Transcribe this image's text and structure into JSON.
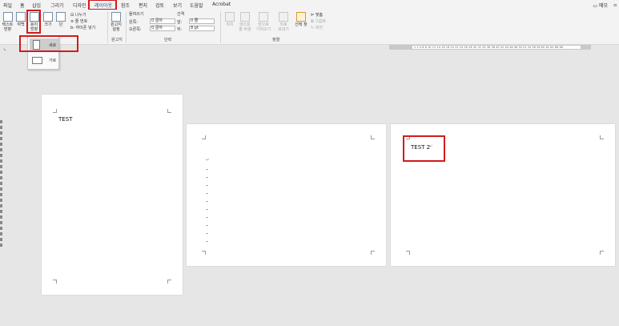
{
  "tabs": [
    {
      "label": "파일"
    },
    {
      "label": "홈"
    },
    {
      "label": "삽입"
    },
    {
      "label": "그리기"
    },
    {
      "label": "디자인"
    },
    {
      "label": "레이아웃"
    },
    {
      "label": "참조"
    },
    {
      "label": "편지"
    },
    {
      "label": "검토"
    },
    {
      "label": "보기"
    },
    {
      "label": "도움말"
    },
    {
      "label": "Acrobat"
    }
  ],
  "header": {
    "memo_label": "메모",
    "share_label": "공유"
  },
  "ribbon": {
    "text_direction": "텍스트\n방향",
    "margins": "여백",
    "orientation": "용지\n방향",
    "size": "크기",
    "columns": "단",
    "breaks": "나누기",
    "line_numbers": "줄 번호",
    "hyphenation": "하이픈 넣기",
    "manuscript": "원고지\n설정",
    "manuscript_group": "원고지",
    "indent_title": "들여쓰기",
    "spacing_title": "간격",
    "left_label": "왼쪽:",
    "left_value": "0 글자",
    "right_label": "오른쪽:",
    "right_value": "0 글자",
    "before_label": "앞:",
    "before_value": "0 줄",
    "after_label": "뒤:",
    "after_value": "8 pt",
    "paragraph_group": "단락",
    "position": "위치",
    "wrap_text": "텍스트\n줄 바꿈",
    "bring_forward": "앞으로\n가져오기",
    "send_backward": "뒤로\n보내기",
    "selection_pane": "선택 창",
    "align": "맞춤",
    "group": "그룹화",
    "rotate": "회전",
    "arrange_group": "정렬"
  },
  "orientation_menu": {
    "items": [
      {
        "label": "세로"
      },
      {
        "label": "가로"
      }
    ]
  },
  "ruler": {
    "numbers": "1 2 4 6 8 10 12 14 16 18 20 22 24 26 28 30 32 34 36 38 40 42 44 46 48 50 52 54 56 58 60 62 64 66 68"
  },
  "pages": [
    {
      "text": "TEST"
    },
    {
      "text": ""
    },
    {
      "text": "TEST 2"
    }
  ]
}
